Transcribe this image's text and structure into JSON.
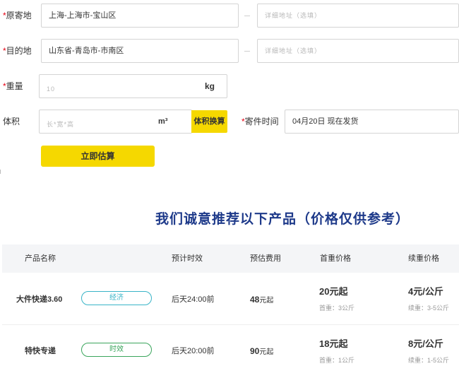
{
  "form": {
    "origin": {
      "label": "原寄地",
      "value": "上海-上海市-宝山区",
      "detail_placeholder": "详细地址（选填）"
    },
    "destination": {
      "label": "目的地",
      "value": "山东省-青岛市-市南区",
      "detail_placeholder": "详细地址（选填）"
    },
    "weight": {
      "label": "重量",
      "placeholder": "10",
      "unit": "kg"
    },
    "volume": {
      "label": "体积",
      "placeholder": "长*宽*高",
      "unit": "m³",
      "convert_label": "体积换算"
    },
    "send_time": {
      "label": "寄件时间",
      "value": "04月20日 现在发货"
    },
    "required_mark": "*",
    "estimate_button": "立即估算"
  },
  "recommend": {
    "title": "我们诚意推荐以下产品（价格仅供参考）",
    "columns": [
      "产品名称",
      "预计时效",
      "预估费用",
      "首重价格",
      "续重价格"
    ],
    "rows": [
      {
        "name": "大件快递3.60",
        "tag": "经济",
        "eta": "后天24:00前",
        "fee": "48",
        "fee_suffix": "元起",
        "first_price": "20元起",
        "first_note": "首重：3公斤",
        "extra_price": "4元/公斤",
        "extra_note": "续重：3-5公斤"
      },
      {
        "name": "特快专递",
        "tag": "时效",
        "eta": "后天20:00前",
        "fee": "90",
        "fee_suffix": "元起",
        "first_price": "18元起",
        "first_note": "首重：1公斤",
        "extra_price": "8元/公斤",
        "extra_note": "续重：1-5公斤"
      }
    ]
  },
  "colors": {
    "accent": "#f5d800",
    "title": "#1e3a8a",
    "required": "#e60012",
    "tag_economy": "#39b4c7",
    "tag_speed": "#3aa55c"
  }
}
